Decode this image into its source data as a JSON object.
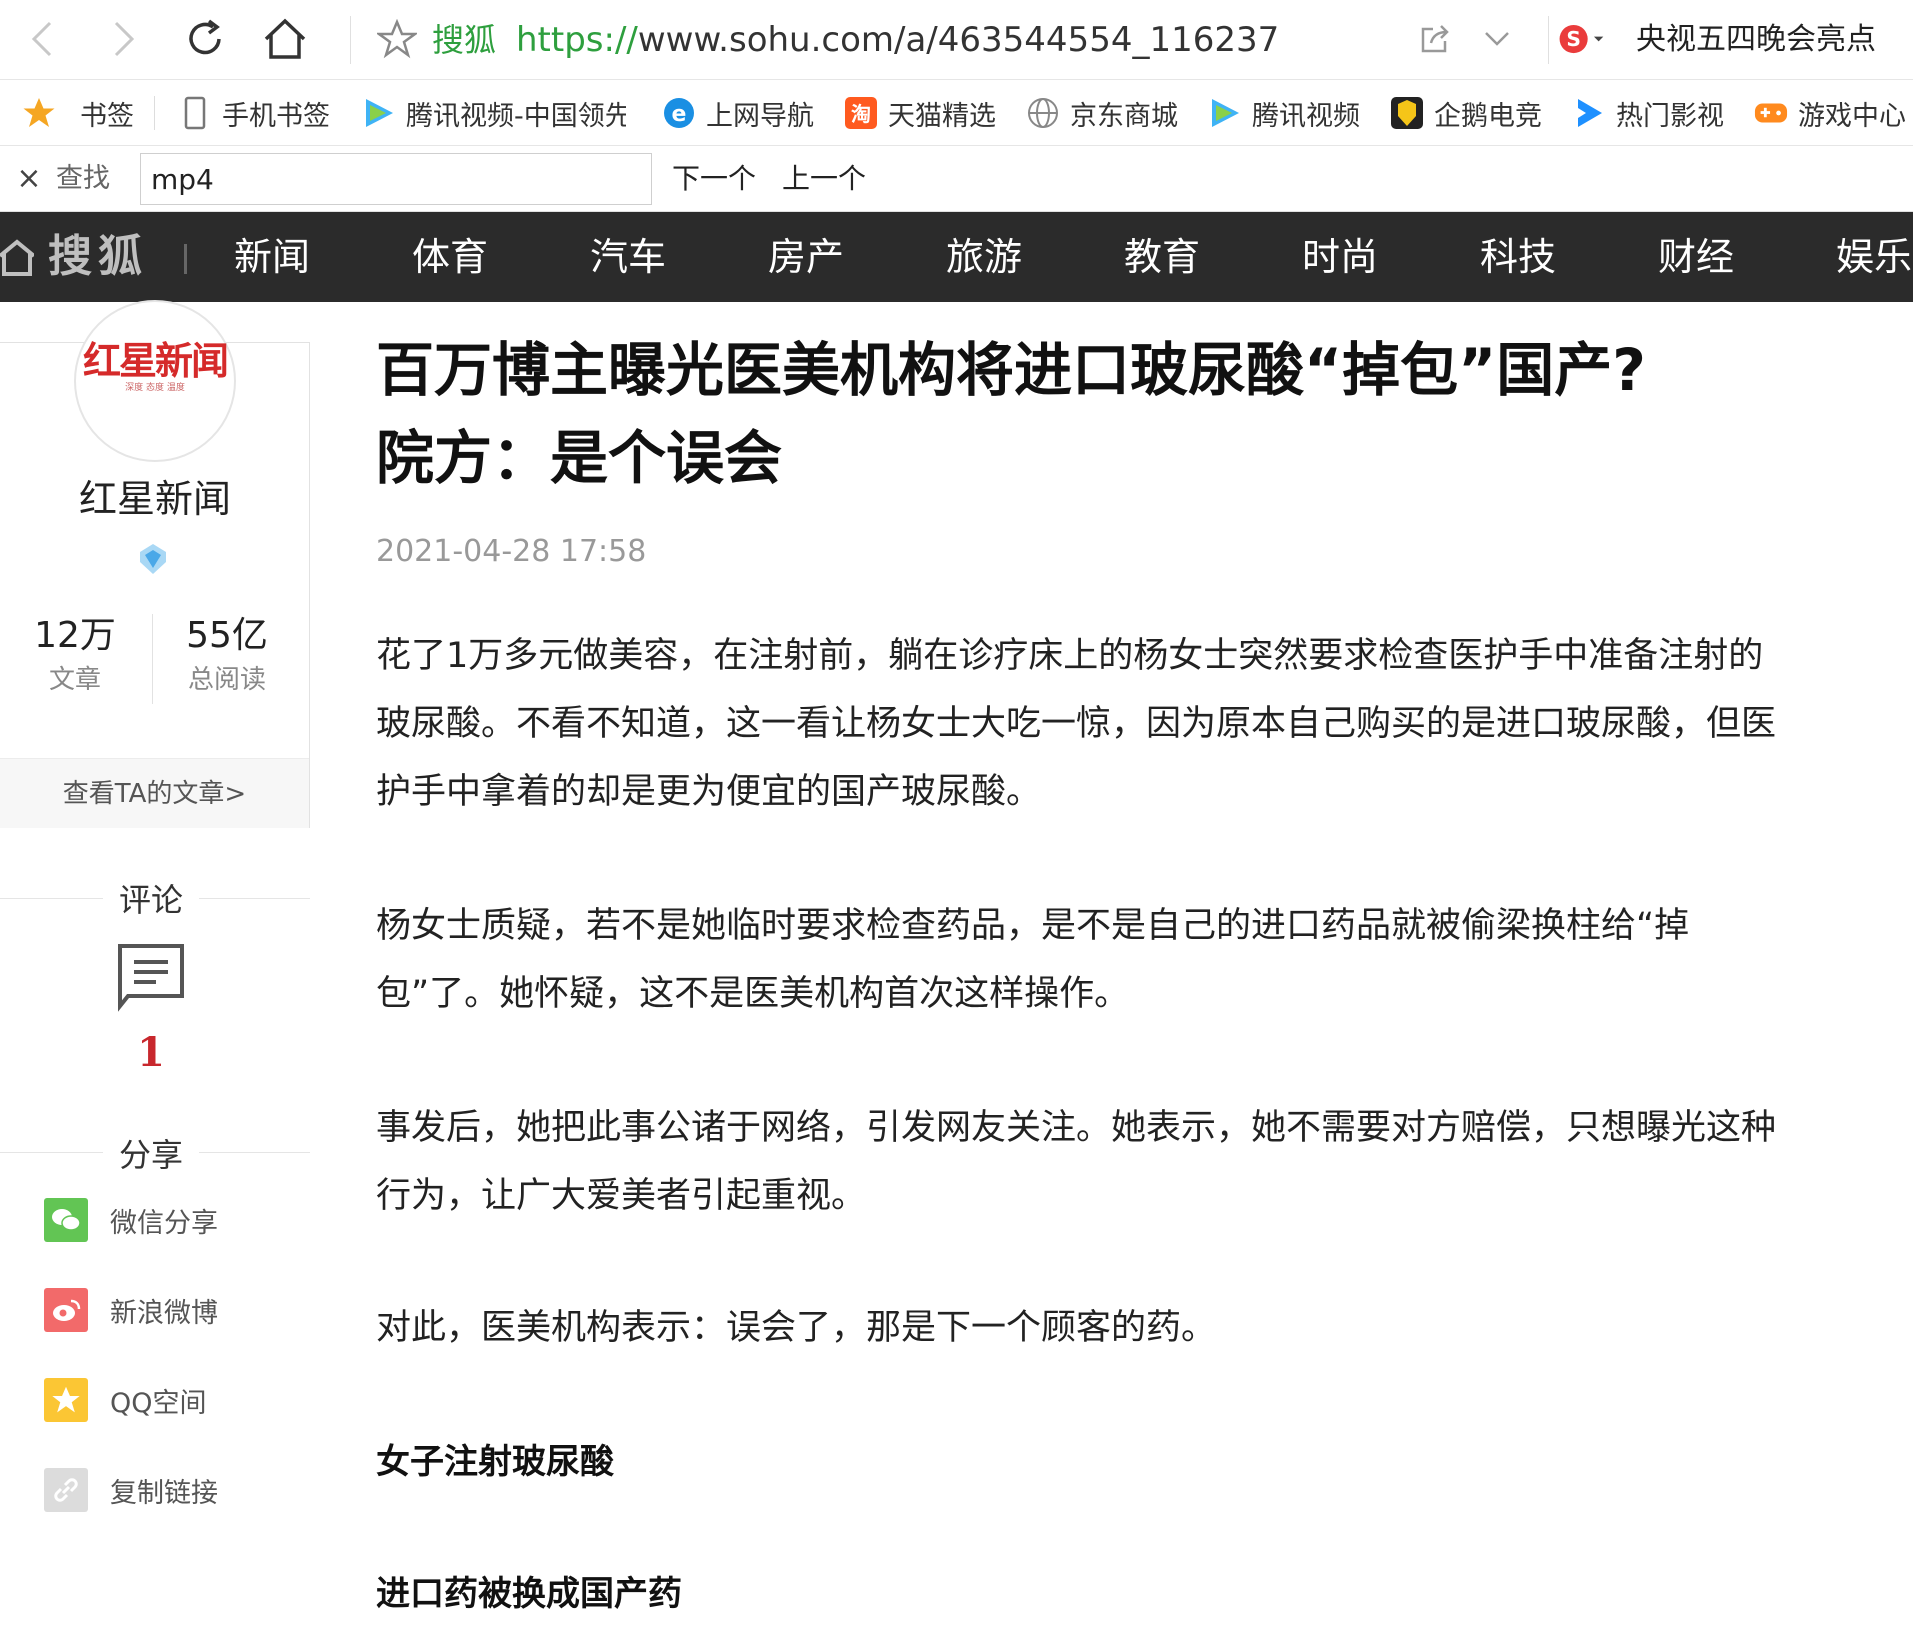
{
  "browser": {
    "site_name": "搜狐",
    "url_protocol": "https://",
    "url_rest": "www.sohu.com/a/463544554_116237",
    "search_hot": "央视五四晚会亮点"
  },
  "bookmarks": [
    {
      "label": "书签",
      "icon": "star-icon"
    },
    {
      "label": "手机书签",
      "icon": "phone-icon"
    },
    {
      "label": "腾讯视频-中国领先",
      "icon": "tencent-video-icon"
    },
    {
      "label": "上网导航",
      "icon": "ie-icon"
    },
    {
      "label": "天猫精选",
      "icon": "tmall-icon"
    },
    {
      "label": "京东商城",
      "icon": "globe-icon"
    },
    {
      "label": "腾讯视频",
      "icon": "tencent-video-icon"
    },
    {
      "label": "企鹅电竞",
      "icon": "penguin-esports-icon"
    },
    {
      "label": "热门影视",
      "icon": "play-icon"
    },
    {
      "label": "游戏中心",
      "icon": "gamepad-icon"
    }
  ],
  "findbar": {
    "label": "查找",
    "value": "mp4",
    "next_label": "下一个",
    "prev_label": "上一个"
  },
  "sitenav": {
    "logo": "搜狐",
    "items": [
      "新闻",
      "体育",
      "汽车",
      "房产",
      "旅游",
      "教育",
      "时尚",
      "科技",
      "财经",
      "娱乐"
    ]
  },
  "author": {
    "logo_text": "红星新闻",
    "logo_sub": "深度 态度 温度",
    "name": "红星新闻",
    "articles_num": "12万",
    "articles_cap": "文章",
    "reads_num": "55亿",
    "reads_cap": "总阅读",
    "view_link": "查看TA的文章>"
  },
  "comments": {
    "title": "评论",
    "count": "1"
  },
  "share": {
    "title": "分享",
    "items": [
      {
        "label": "微信分享",
        "color": "#62c554"
      },
      {
        "label": "新浪微博",
        "color": "#f26a6a"
      },
      {
        "label": "QQ空间",
        "color": "#fbc634"
      },
      {
        "label": "复制链接",
        "color": "#dcdcdc"
      }
    ]
  },
  "article": {
    "title_line1": "百万博主曝光医美机构将进口玻尿酸“掉包”国产?",
    "title_line2": "院方：是个误会",
    "date": "2021-04-28 17:58",
    "p1_l1": "花了1万多元做美容，在注射前，躺在诊疗床上的杨女士突然要求检查医护手中准备注射的",
    "p1_l2": "玻尿酸。不看不知道，这一看让杨女士大吃一惊，因为原本自己购买的是进口玻尿酸，但医",
    "p1_l3": "护手中拿着的却是更为便宜的国产玻尿酸。",
    "p2_l1": "杨女士质疑，若不是她临时要求检查药品，是不是自己的进口药品就被偷梁换柱给“掉",
    "p2_l2": "包”了。她怀疑，这不是医美机构首次这样操作。",
    "p3_l1": "事发后，她把此事公诸于网络，引发网友关注。她表示，她不需要对方赔偿，只想曝光这种",
    "p3_l2": "行为，让广大爱美者引起重视。",
    "p4_l1": "对此，医美机构表示：误会了，那是下一个顾客的药。",
    "subhead1": "女子注射玻尿酸",
    "subhead2": "进口药被换成国产药"
  }
}
